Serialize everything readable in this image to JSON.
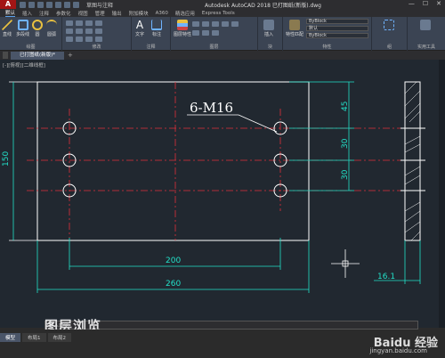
{
  "app": {
    "logo": "A",
    "workspace": "草图与注释",
    "title": "Autodesk AutoCAD 2018    已打图纸(新版).dwg"
  },
  "window_controls": [
    "—",
    "☐",
    "✕"
  ],
  "menu_tabs": [
    "默认",
    "插入",
    "注释",
    "参数化",
    "视图",
    "管理",
    "输出",
    "附加模块",
    "A360",
    "精选应用",
    "Express Tools"
  ],
  "active_tab": "默认",
  "ribbon": {
    "draw_panel": {
      "title": "绘图",
      "buttons": [
        "直线",
        "多段线",
        "圆",
        "圆弧"
      ]
    },
    "modify_panel": {
      "title": "修改",
      "buttons": [
        "移动",
        "旋转",
        "复制",
        "镜像",
        "拉伸",
        "缩放"
      ]
    },
    "annotation_panel": {
      "title": "注释",
      "buttons": [
        "文字",
        "标注"
      ]
    },
    "layers_panel": {
      "title": "图层",
      "buttons": [
        "图层特性"
      ]
    },
    "block_panel": {
      "title": "块",
      "buttons": [
        "插入"
      ]
    },
    "properties_panel": {
      "title": "特性",
      "buttons": [
        "特性匹配"
      ],
      "color": "ByBlock",
      "lineweight": "默认",
      "linetype": "ByBlock"
    },
    "groups_panel": {
      "title": "组"
    },
    "utilities_panel": {
      "title": "实用工具"
    }
  },
  "doc_tab": "已打图纸(新版)*",
  "viewport_label": "[-][俯视][二维线框]",
  "drawing": {
    "leader_text": "6-M16",
    "dims": {
      "height_left": "150",
      "v_top": "45",
      "v_mid": "30",
      "v_bot": "30",
      "h_inner": "200",
      "h_outer": "260",
      "section_width": "16.1"
    }
  },
  "overlay_text": "图层浏览",
  "cmdline_placeholder": "键入命令",
  "layout_tabs": [
    "模型",
    "布局1",
    "布局2"
  ],
  "active_layout": "模型",
  "watermark": {
    "logo": "Baidu 经验",
    "url": "jingyan.baidu.com"
  },
  "colors": {
    "background": "#212830",
    "outline": "#ffffff",
    "centerline": "#e0303a",
    "dimension": "#22e0c8",
    "leader": "#ffffff",
    "dim_text": "#1ed760"
  }
}
